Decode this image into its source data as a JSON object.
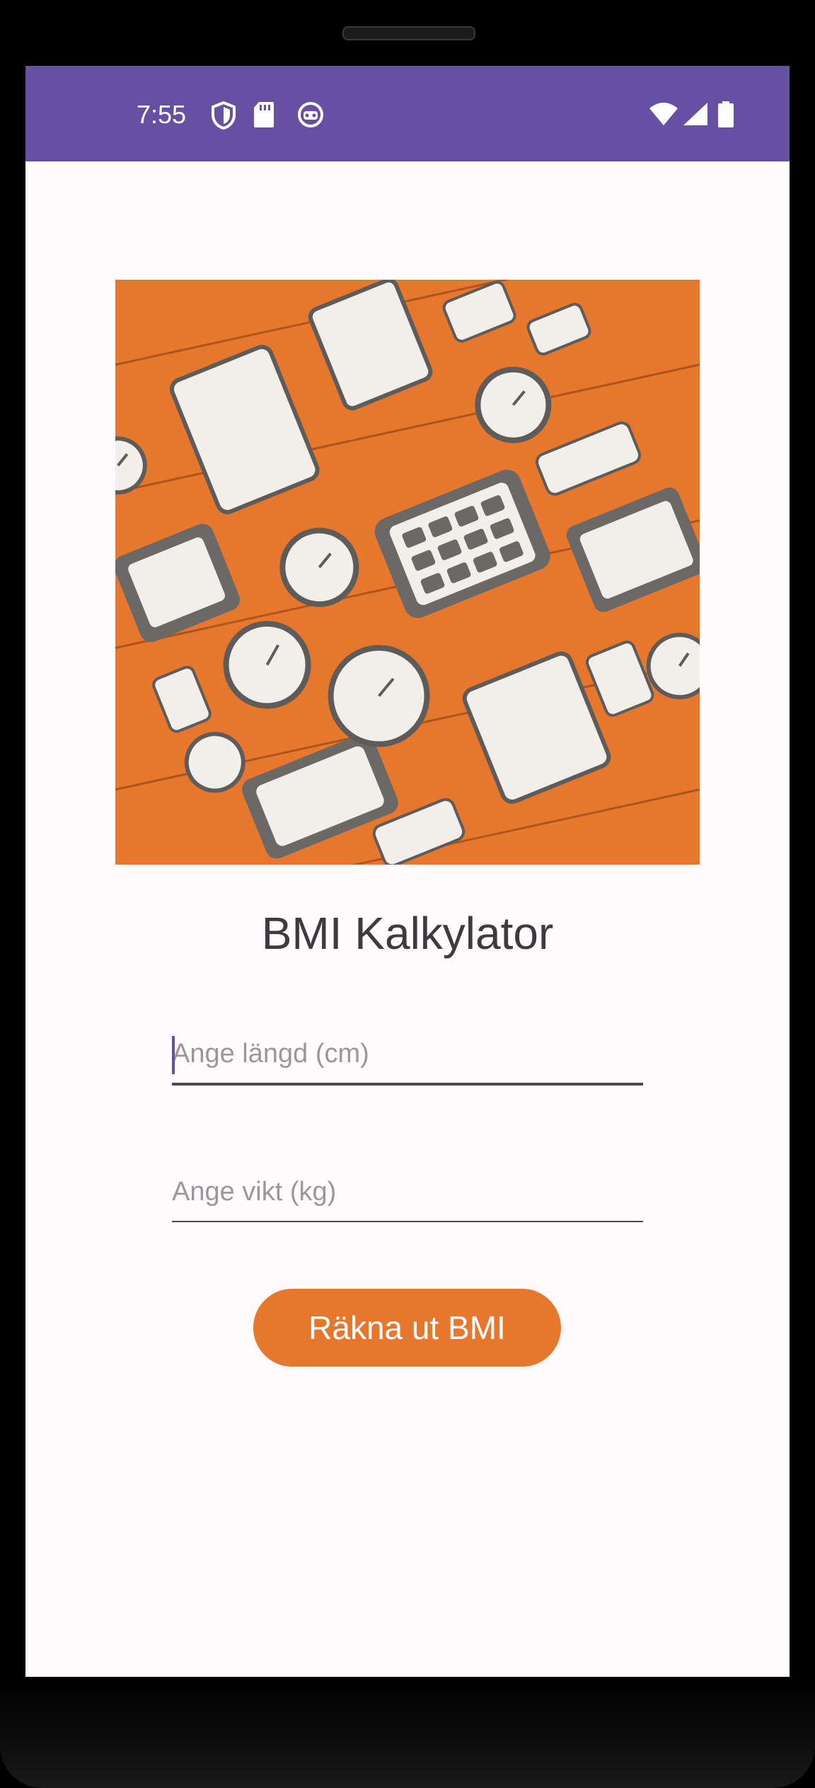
{
  "statusbar": {
    "time": "7:55",
    "icons_left": [
      "shield-icon",
      "sd-card-icon",
      "robot-icon"
    ],
    "icons_right": [
      "wifi-icon",
      "signal-icon",
      "battery-icon"
    ],
    "color": "#6750a4"
  },
  "hero_image": {
    "description_icon": "calculators-illustration"
  },
  "title": "BMI Kalkylator",
  "height_field": {
    "placeholder": "Ange längd (cm)",
    "value": ""
  },
  "weight_field": {
    "placeholder": "Ange vikt (kg)",
    "value": ""
  },
  "calculate_button": {
    "label": "Räkna ut BMI",
    "color": "#e8772e"
  },
  "colors": {
    "accent": "#e8772e",
    "background": "#fffbfd",
    "text": "#3d3a40"
  }
}
